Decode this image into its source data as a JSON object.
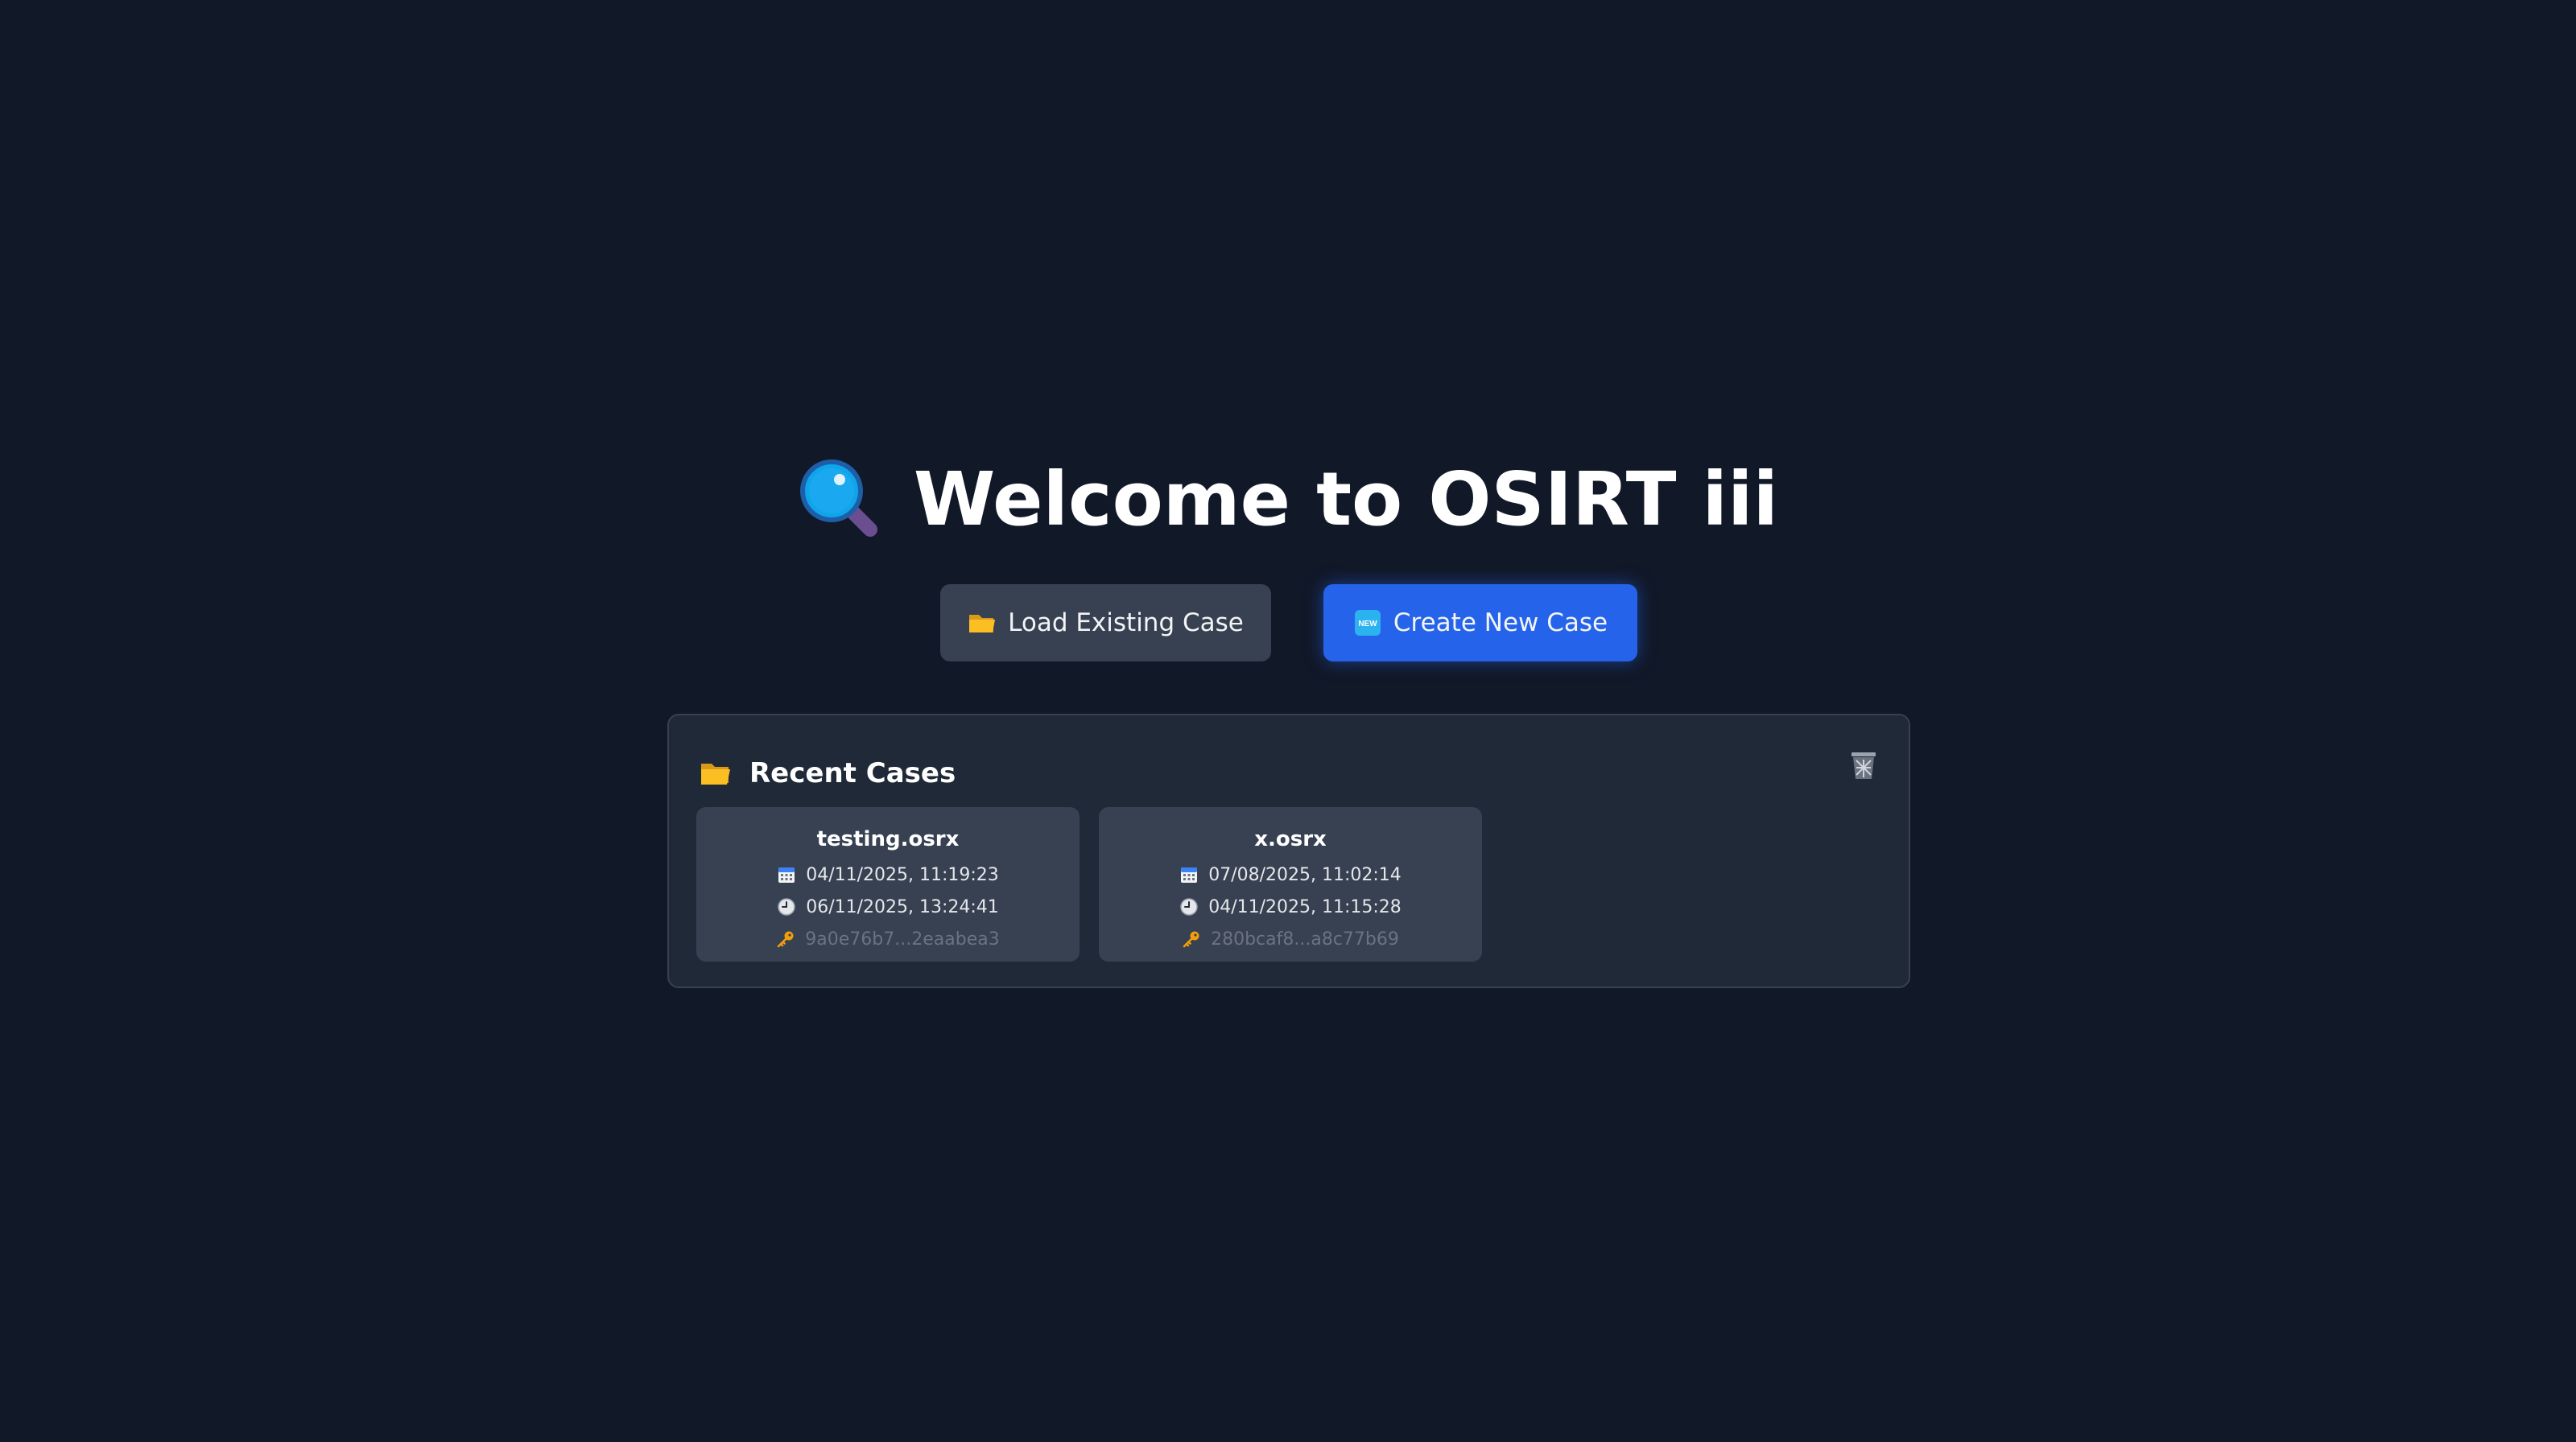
{
  "welcome": {
    "icon": "magnifier-icon",
    "title": "Welcome to OSIRT iii"
  },
  "actions": {
    "load": {
      "icon": "folder-icon",
      "label": "Load Existing Case"
    },
    "create": {
      "icon": "new-badge-icon",
      "label": "Create New Case"
    }
  },
  "recent": {
    "icon": "folder-icon",
    "title": "Recent Cases",
    "clear_icon": "wastebasket-icon",
    "cases": [
      {
        "name": "testing.osrx",
        "created": "04/11/2025, 11:19:23",
        "modified": "06/11/2025, 13:24:41",
        "hash": "9a0e76b7...2eaabea3"
      },
      {
        "name": "x.osrx",
        "created": "07/08/2025, 11:02:14",
        "modified": "04/11/2025, 11:15:28",
        "hash": "280bcaf8...a8c77b69"
      }
    ]
  },
  "colors": {
    "background": "#111827",
    "panel": "#1f2937",
    "card": "#374151",
    "accent": "#2563eb"
  }
}
